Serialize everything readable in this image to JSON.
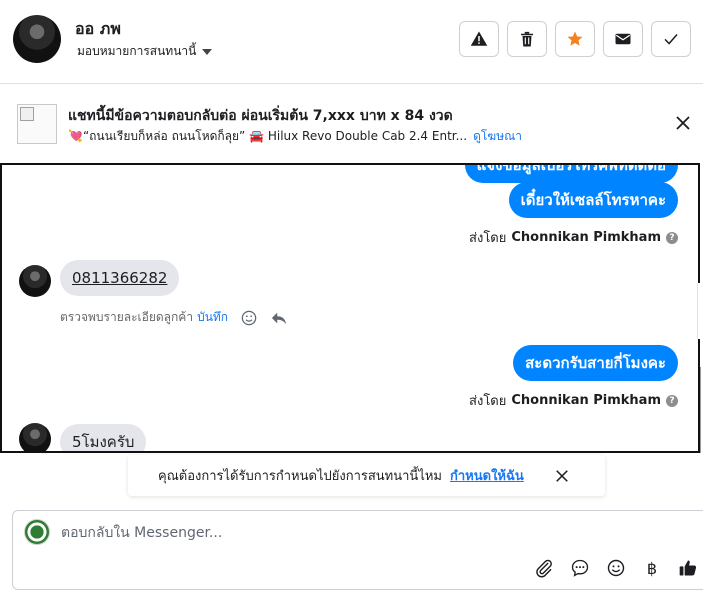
{
  "header": {
    "contact_name": "ออ ภพ",
    "assign_label": "มอบหมายการสนทนานี้",
    "buttons": [
      {
        "icon": "alert-icon",
        "label": "spam"
      },
      {
        "icon": "trash-icon",
        "label": "delete"
      },
      {
        "icon": "star-icon",
        "label": "star",
        "color": "#f5821f"
      },
      {
        "icon": "mail-icon",
        "label": "mark unread"
      },
      {
        "icon": "check-icon",
        "label": "done"
      }
    ]
  },
  "ad_banner": {
    "title": "แชทนี้มีข้อความตอบกลับต่อ ผ่อนเริ่มต้น 7,xxx บาท x 84 งวด",
    "subtitle": "💘“ถนนเรียบก็หล่อ ถนนโหดก็ลุย” 🚘 Hilux Revo Double Cab 2.4 Entr...",
    "link": "ดูโฆษณา"
  },
  "messages": [
    {
      "direction": "out",
      "text": "เดี๋ยวให้เซลล์โทรหาคะ"
    },
    {
      "direction": "in",
      "text": "0811366282"
    },
    {
      "direction": "out",
      "text": "สะดวกรับสายกี่โมงคะ"
    },
    {
      "direction": "in",
      "text": "5โมงครับ"
    }
  ],
  "partial_message_top": "แจ้งข้อมูลเบอร์โทรศัพท์ติดต่อ",
  "sent_by": {
    "prefix": "ส่งโดย",
    "name": "Chonnikan Pimkham"
  },
  "detail_row": {
    "text": "ตรวจพบรายละเอียดลูกค้า",
    "save_label": "บันทึก"
  },
  "assign_prompt": {
    "text": "คุณต้องการได้รับการกำหนดไปยังการสนทนานี้ไหม",
    "link": "กำหนดให้ฉัน"
  },
  "composer": {
    "placeholder": "ตอบกลับใน Messenger...",
    "tools": [
      "attach-icon",
      "saved-reply-icon",
      "emoji-icon",
      "baht-icon",
      "like-icon"
    ],
    "baht_symbol": "฿"
  },
  "colors": {
    "accent": "#0084ff",
    "link": "#1877f2",
    "incoming_bubble": "#e4e6eb",
    "star": "#f5821f"
  }
}
